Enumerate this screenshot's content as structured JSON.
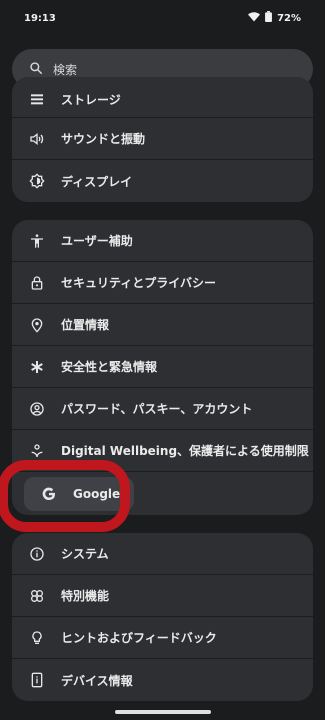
{
  "status": {
    "time": "19:13",
    "battery": "72%"
  },
  "search": {
    "placeholder": "検索"
  },
  "group1": [
    {
      "label": "ストレージ",
      "icon": "storage-icon"
    },
    {
      "label": "サウンドと振動",
      "icon": "volume-icon"
    },
    {
      "label": "ディスプレイ",
      "icon": "brightness-icon"
    }
  ],
  "group2": [
    {
      "label": "ユーザー補助",
      "icon": "accessibility-icon"
    },
    {
      "label": "セキュリティとプライバシー",
      "icon": "lock-icon"
    },
    {
      "label": "位置情報",
      "icon": "location-icon"
    },
    {
      "label": "安全性と緊急情報",
      "icon": "asterisk-icon"
    },
    {
      "label": "パスワード、パスキー、アカウント",
      "icon": "account-circle-icon"
    },
    {
      "label": "Digital Wellbeing、保護者による使用制限",
      "icon": "wellbeing-icon"
    },
    {
      "label": "Google",
      "icon": "google-icon"
    }
  ],
  "group3": [
    {
      "label": "システム",
      "icon": "info-icon"
    },
    {
      "label": "特別機能",
      "icon": "special-features-icon"
    },
    {
      "label": "ヒントおよびフィードバック",
      "icon": "lightbulb-icon"
    },
    {
      "label": "デバイス情報",
      "icon": "device-info-icon"
    }
  ]
}
